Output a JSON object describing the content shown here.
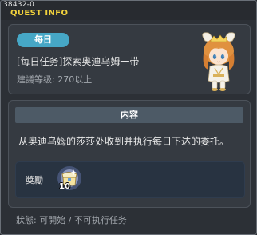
{
  "window": {
    "quest_id": "38432-0",
    "title": "QUEST INFO"
  },
  "quest": {
    "badge": "每日",
    "name": "[每日任务]探索奥迪乌姆一带",
    "level_requirement": "建議等级: 270以上"
  },
  "content": {
    "section_title": "内容",
    "description": "从奥迪乌姆的莎莎处收到并执行每日下达的委托。",
    "reward_label": "獎勵",
    "reward_item": {
      "icon": "gem-chest-icon",
      "quantity": "10"
    }
  },
  "status": {
    "text": "狀態: 可開始 / 不可执行任务"
  },
  "colors": {
    "title": "#f2d23c",
    "badge": "#46a7c6",
    "section_bar": "#4d5a66",
    "window_bg": "#2c3036"
  }
}
